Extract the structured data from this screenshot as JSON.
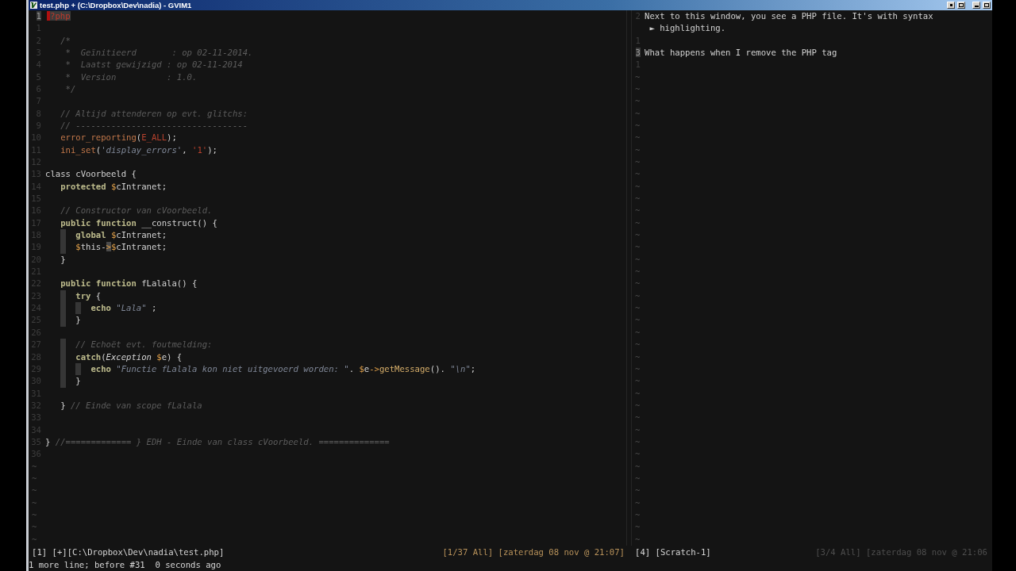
{
  "window": {
    "title": "test.php + (C:\\Dropbox\\Dev\\nadia) - GVIM1"
  },
  "panes": [
    {
      "kind": "code",
      "lines": [
        {
          "number": "1",
          "current": true,
          "tokens": [
            {
              "kind": "tag",
              "text": "?php"
            }
          ]
        },
        {
          "number": "1",
          "current": false
        },
        {
          "number": "2",
          "current": false,
          "indent": [
            {
              "guide": false
            }
          ],
          "tokens": [
            {
              "kind": "comment",
              "text": "/*"
            }
          ]
        },
        {
          "number": "3",
          "current": false,
          "indent": [
            {
              "guide": false
            }
          ],
          "tokens": [
            {
              "kind": "comment",
              "text": " *  Geïnitieerd       : op 02-11-2014."
            }
          ]
        },
        {
          "number": "4",
          "current": false,
          "indent": [
            {
              "guide": false
            }
          ],
          "tokens": [
            {
              "kind": "comment",
              "text": " *  Laatst gewijzigd : op 02-11-2014"
            }
          ]
        },
        {
          "number": "5",
          "current": false,
          "indent": [
            {
              "guide": false
            }
          ],
          "tokens": [
            {
              "kind": "comment",
              "text": " *  Version          : 1.0."
            }
          ]
        },
        {
          "number": "6",
          "current": false,
          "indent": [
            {
              "guide": false
            }
          ],
          "tokens": [
            {
              "kind": "comment",
              "text": " */"
            }
          ]
        },
        {
          "number": "7",
          "current": false
        },
        {
          "number": "8",
          "current": false,
          "indent": [
            {
              "guide": false
            }
          ],
          "tokens": [
            {
              "kind": "comment",
              "text": "// Altijd attenderen op evt. glitchs:"
            }
          ]
        },
        {
          "number": "9",
          "current": false,
          "indent": [
            {
              "guide": false
            }
          ],
          "tokens": [
            {
              "kind": "comment",
              "text": "// ----------------------------------"
            }
          ]
        },
        {
          "number": "10",
          "current": false,
          "indent": [
            {
              "guide": false
            }
          ],
          "tokens": [
            {
              "kind": "function",
              "text": "error_reporting"
            },
            {
              "kind": "plain",
              "text": "("
            },
            {
              "kind": "constant",
              "text": "E_ALL"
            },
            {
              "kind": "plain",
              "text": ");"
            }
          ]
        },
        {
          "number": "11",
          "current": false,
          "indent": [
            {
              "guide": false
            }
          ],
          "tokens": [
            {
              "kind": "function",
              "text": "ini_set"
            },
            {
              "kind": "plain",
              "text": "("
            },
            {
              "kind": "string",
              "text": "'display_errors'"
            },
            {
              "kind": "plain",
              "text": ", "
            },
            {
              "kind": "constant",
              "text": "'1'"
            },
            {
              "kind": "plain",
              "text": ");"
            }
          ]
        },
        {
          "number": "12",
          "current": false
        },
        {
          "number": "13",
          "current": false,
          "tokens": [
            {
              "kind": "plain",
              "text": "class cVoorbeeld {"
            }
          ]
        },
        {
          "number": "14",
          "current": false,
          "indent": [
            {
              "guide": false
            }
          ],
          "tokens": [
            {
              "kind": "keyword",
              "text": "protected "
            },
            {
              "kind": "sigil",
              "text": "$"
            },
            {
              "kind": "plain",
              "text": "cIntranet;"
            }
          ]
        },
        {
          "number": "15",
          "current": false
        },
        {
          "number": "16",
          "current": false,
          "indent": [
            {
              "guide": false
            }
          ],
          "tokens": [
            {
              "kind": "comment",
              "text": "// Constructor van cVoorbeeld."
            }
          ]
        },
        {
          "number": "17",
          "current": false,
          "indent": [
            {
              "guide": false
            }
          ],
          "tokens": [
            {
              "kind": "keyword",
              "text": "public function"
            },
            {
              "kind": "plain",
              "text": " __construct() {"
            }
          ]
        },
        {
          "number": "18",
          "current": false,
          "indent": [
            {
              "guide": false
            },
            {
              "guide": true
            }
          ],
          "tokens": [
            {
              "kind": "keyword",
              "text": "global "
            },
            {
              "kind": "sigil",
              "text": "$"
            },
            {
              "kind": "plain",
              "text": "cIntranet;"
            }
          ]
        },
        {
          "number": "19",
          "current": false,
          "indent": [
            {
              "guide": false
            },
            {
              "guide": true
            }
          ],
          "tokens": [
            {
              "kind": "sigil",
              "text": "$"
            },
            {
              "kind": "plain",
              "text": "this-"
            },
            {
              "kind": "match",
              "text": ">"
            },
            {
              "kind": "sigil",
              "text": "$"
            },
            {
              "kind": "plain",
              "text": "cIntranet;"
            }
          ]
        },
        {
          "number": "20",
          "current": false,
          "indent": [
            {
              "guide": false
            }
          ],
          "tokens": [
            {
              "kind": "plain",
              "text": "}"
            }
          ]
        },
        {
          "number": "21",
          "current": false
        },
        {
          "number": "22",
          "current": false,
          "indent": [
            {
              "guide": false
            }
          ],
          "tokens": [
            {
              "kind": "keyword",
              "text": "public function"
            },
            {
              "kind": "plain",
              "text": " fLalala() {"
            }
          ]
        },
        {
          "number": "23",
          "current": false,
          "indent": [
            {
              "guide": false
            },
            {
              "guide": true
            }
          ],
          "tokens": [
            {
              "kind": "keyword",
              "text": "try"
            },
            {
              "kind": "plain",
              "text": " {"
            }
          ]
        },
        {
          "number": "24",
          "current": false,
          "indent": [
            {
              "guide": false
            },
            {
              "guide": true
            },
            {
              "guide": true
            }
          ],
          "tokens": [
            {
              "kind": "keyword",
              "text": "echo "
            },
            {
              "kind": "string",
              "text": "\"Lala\""
            },
            {
              "kind": "plain",
              "text": " ;"
            }
          ]
        },
        {
          "number": "25",
          "current": false,
          "indent": [
            {
              "guide": false
            },
            {
              "guide": true
            }
          ],
          "tokens": [
            {
              "kind": "plain",
              "text": "}"
            }
          ]
        },
        {
          "number": "26",
          "current": false
        },
        {
          "number": "27",
          "current": false,
          "indent": [
            {
              "guide": false
            },
            {
              "guide": true
            }
          ],
          "tokens": [
            {
              "kind": "comment",
              "text": "// Echoët evt. foutmelding:"
            }
          ]
        },
        {
          "number": "28",
          "current": false,
          "indent": [
            {
              "guide": false
            },
            {
              "guide": true
            }
          ],
          "tokens": [
            {
              "kind": "keyword",
              "text": "catch"
            },
            {
              "kind": "plain",
              "text": "("
            },
            {
              "kind": "type",
              "text": "Exception "
            },
            {
              "kind": "sigil",
              "text": "$"
            },
            {
              "kind": "plain",
              "text": "e) {"
            }
          ]
        },
        {
          "number": "29",
          "current": false,
          "indent": [
            {
              "guide": false
            },
            {
              "guide": true
            },
            {
              "guide": true
            }
          ],
          "tokens": [
            {
              "kind": "keyword",
              "text": "echo "
            },
            {
              "kind": "string",
              "text": "\"Functie fLalala kon niet uitgevoerd worden: \""
            },
            {
              "kind": "plain",
              "text": ". "
            },
            {
              "kind": "sigil",
              "text": "$"
            },
            {
              "kind": "plain",
              "text": "e"
            },
            {
              "kind": "sigil",
              "text": "->"
            },
            {
              "kind": "method",
              "text": "getMessage"
            },
            {
              "kind": "plain",
              "text": "(). "
            },
            {
              "kind": "string",
              "text": "\"\\n\""
            },
            {
              "kind": "plain",
              "text": ";"
            }
          ]
        },
        {
          "number": "30",
          "current": false,
          "indent": [
            {
              "guide": false
            },
            {
              "guide": true
            }
          ],
          "tokens": [
            {
              "kind": "plain",
              "text": "}"
            }
          ]
        },
        {
          "number": "31",
          "current": false
        },
        {
          "number": "32",
          "current": false,
          "indent": [
            {
              "guide": false
            }
          ],
          "tokens": [
            {
              "kind": "plain",
              "text": "} "
            },
            {
              "kind": "comment",
              "text": "// Einde van scope fLalala"
            }
          ]
        },
        {
          "number": "33",
          "current": false
        },
        {
          "number": "34",
          "current": false
        },
        {
          "number": "35",
          "current": false,
          "tokens": [
            {
              "kind": "plain",
              "text": "} "
            },
            {
              "kind": "comment",
              "text": "//============= } EDH - Einde van class cVoorbeeld. =============="
            }
          ]
        },
        {
          "number": "36",
          "current": false
        }
      ],
      "filler": [
        "~",
        "~",
        "~",
        "~",
        "~",
        "~",
        "~"
      ],
      "status": {
        "left": "[1] [+][C:\\Dropbox\\Dev\\nadia\\test.php]",
        "right": "[1/37 All] [zaterdag 08 nov @ 21:07]",
        "active": true
      }
    },
    {
      "kind": "text",
      "lines": [
        {
          "number": "2",
          "current": false,
          "text": "Next to this window, you see a PHP file. It's with syntax",
          "wrap": "► highlighting."
        },
        {
          "number": "1",
          "current": false
        },
        {
          "number": "3",
          "current": true,
          "text": "What happens when I remove the PHP tag"
        },
        {
          "number": "1",
          "current": false
        }
      ],
      "filler": [
        "~",
        "~",
        "~",
        "~",
        "~",
        "~",
        "~",
        "~",
        "~",
        "~",
        "~",
        "~",
        "~",
        "~",
        "~",
        "~",
        "~",
        "~",
        "~",
        "~",
        "~",
        "~",
        "~",
        "~",
        "~",
        "~",
        "~",
        "~",
        "~",
        "~",
        "~",
        "~",
        "~",
        "~",
        "~",
        "~",
        "~",
        "~",
        "~"
      ],
      "status": {
        "left": "[4] [Scratch-1]",
        "right": "[3/4 All] [zaterdag 08 nov @ 21:06",
        "active": false
      }
    }
  ],
  "message": "1 more line; before #31  0 seconds ago"
}
